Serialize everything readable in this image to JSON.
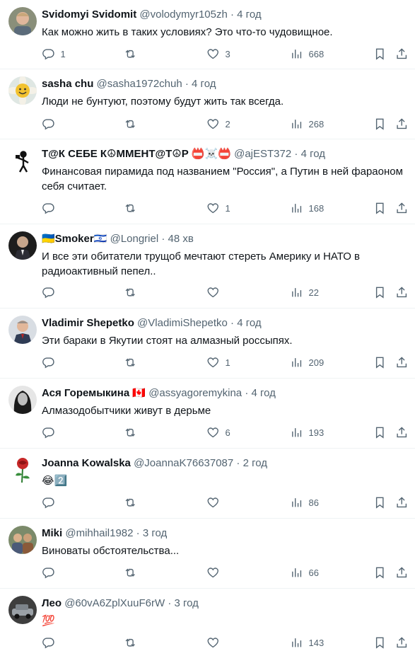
{
  "tweets": [
    {
      "name": "Svidomyi Svidomit",
      "handle": "@volodymyr105zh",
      "dot": "·",
      "time": "4 год",
      "text": "Как можно жить в таких условиях? Это что-то чудовищное.",
      "replies": "1",
      "retweets": "",
      "likes": "3",
      "views": "668",
      "avatar": "man-portrait"
    },
    {
      "name": "sasha chu",
      "handle": "@sasha1972chuh",
      "dot": "·",
      "time": "4 год",
      "text": "Люди не бунтуют, поэтому будут жить так всегда.",
      "replies": "",
      "retweets": "",
      "likes": "2",
      "views": "268",
      "avatar": "flower-smiley"
    },
    {
      "name": "Т@К СЕБЕ К☮ММЕНТ@Т☮Р 📛☠️📛",
      "handle": "@ajEST372",
      "dot": "·",
      "time": "4 год",
      "text": "Финансовая пирамида под названием \"Россия\", а Путин в ней фараоном себя считает.",
      "replies": "",
      "retweets": "",
      "likes": "1",
      "views": "168",
      "avatar": "stick-figure"
    },
    {
      "name": "🇺🇦Smoker🇮🇱",
      "handle": "@Longriel",
      "dot": "·",
      "time": "48 хв",
      "text": "И все эти обитатели трущоб мечтают стереть Америку и НАТО в радиоактивный пепел..",
      "replies": "",
      "retweets": "",
      "likes": "",
      "views": "22",
      "avatar": "man-suit"
    },
    {
      "name": "Vladimir Shepetko",
      "handle": "@VladimiShepetko",
      "dot": "·",
      "time": "4 год",
      "text": "Эти бараки в Якутии стоят на алмазный россыпях.",
      "replies": "",
      "retweets": "",
      "likes": "1",
      "views": "209",
      "avatar": "man-photo"
    },
    {
      "name": "Ася Горемыкина 🇨🇦",
      "handle": "@assyagoremykina",
      "dot": "·",
      "time": "4 год",
      "text": "Алмазодобытчики живут в дерьме",
      "replies": "",
      "retweets": "",
      "likes": "6",
      "views": "193",
      "avatar": "woman-bw"
    },
    {
      "name": "Joanna Kowalska",
      "handle": "@JoannaK76637087",
      "dot": "·",
      "time": "2 год",
      "text": "😂2️⃣",
      "replies": "",
      "retweets": "",
      "likes": "",
      "views": "86",
      "avatar": "rose"
    },
    {
      "name": "Miki",
      "handle": "@mihhail1982",
      "dot": "·",
      "time": "3 год",
      "text": "Виноваты обстоятельства...",
      "replies": "",
      "retweets": "",
      "likes": "",
      "views": "66",
      "avatar": "group"
    },
    {
      "name": "Лео",
      "handle": "@60vA6ZplXuuF6rW",
      "dot": "·",
      "time": "3 год",
      "text": "💯",
      "replies": "",
      "retweets": "",
      "likes": "",
      "views": "143",
      "avatar": "car"
    }
  ],
  "icons": {
    "reply": "reply-icon",
    "retweet": "retweet-icon",
    "like": "heart-icon",
    "views": "views-icon",
    "bookmark": "bookmark-icon",
    "share": "share-icon"
  },
  "colors": {
    "text": "#0f1419",
    "secondary": "#536471",
    "divider": "#eff3f4"
  }
}
